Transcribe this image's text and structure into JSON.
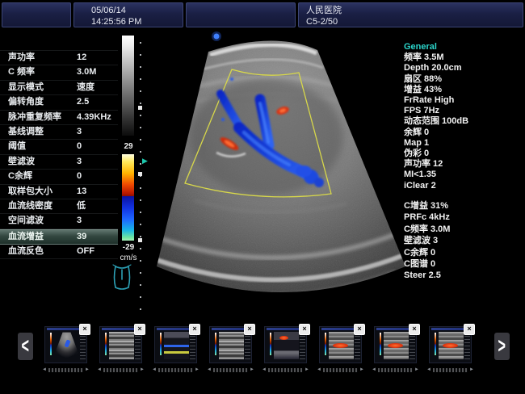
{
  "header": {
    "datetime": {
      "date": "05/06/14",
      "time": "14:25:56 PM"
    },
    "hospital_name": "人民医院",
    "probe_model": "C5-2/50"
  },
  "left_panel": {
    "rows": [
      {
        "label": "声功率",
        "value": "12"
      },
      {
        "label": "C 频率",
        "value": "3.0M"
      },
      {
        "label": "显示模式",
        "value": "速度"
      },
      {
        "label": "偏转角度",
        "value": "2.5"
      },
      {
        "label": "脉冲重复频率",
        "value": "4.39KHz"
      },
      {
        "label": "基线调整",
        "value": "3"
      },
      {
        "label": "阈值",
        "value": "0"
      },
      {
        "label": "壁滤波",
        "value": "3"
      },
      {
        "label": "C余辉",
        "value": "0"
      },
      {
        "label": "取样包大小",
        "value": "13"
      },
      {
        "label": "血流线密度",
        "value": "低"
      },
      {
        "label": "空间滤波",
        "value": "3"
      },
      {
        "label": "血流增益",
        "value": "39",
        "selected": true
      },
      {
        "label": "血流反色",
        "value": "OFF"
      }
    ]
  },
  "color_scale": {
    "max": "29",
    "min": "-29",
    "unit": "cm/s"
  },
  "right_panel": {
    "general": {
      "header": "General",
      "rows": [
        "频率 3.5M",
        "Depth 20.0cm",
        "扇区 88%",
        "增益 43%",
        "FrRate High",
        "FPS 7Hz",
        "动态范围 100dB",
        "余辉 0",
        "Map 1",
        "伪彩 0",
        "声功率 12",
        "MI<1.35",
        "iClear 2"
      ]
    },
    "color_params": {
      "rows": [
        "C增益 31%",
        "PRFc 4kHz",
        "C频率 3.0M",
        "壁滤波 3",
        "C余辉 0",
        "C图谱 0",
        "Steer 2.5"
      ]
    }
  },
  "thumbstrip": {
    "prev_glyph": "<",
    "next_glyph": ">",
    "close_glyph": "×",
    "thumbnails": [
      {
        "variant": "color-fan"
      },
      {
        "variant": "linear-gray"
      },
      {
        "variant": "spectral-blue"
      },
      {
        "variant": "linear-gray"
      },
      {
        "variant": "spectral-red"
      },
      {
        "variant": "red-flow"
      },
      {
        "variant": "red-flow"
      },
      {
        "variant": "red-flow"
      }
    ]
  },
  "colors": {
    "accent_cyan": "#2bd4ca",
    "roi_yellow": "#d8d84a",
    "flow_blue": "#1e4ae0",
    "flow_red": "#df3512",
    "topbar_navy": "#1b2145",
    "highlight_row": "#32463f"
  }
}
